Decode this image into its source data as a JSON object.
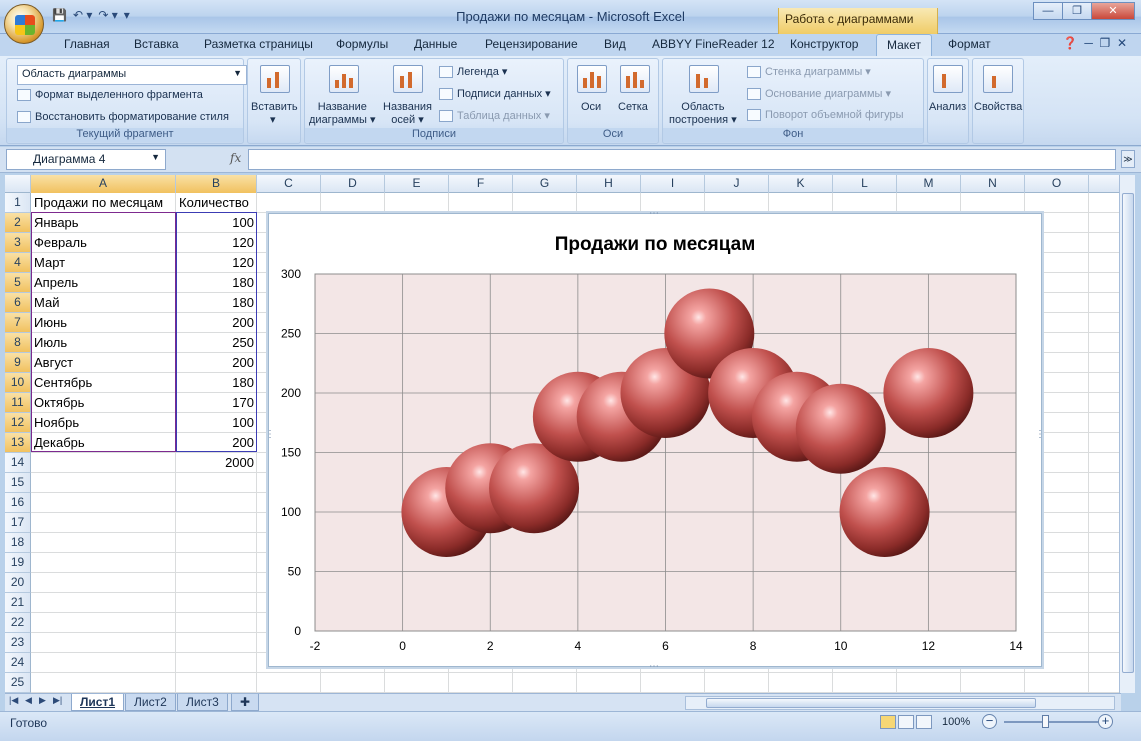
{
  "window": {
    "title": "Продажи по месяцам - Microsoft Excel",
    "context_title": "Работа с диаграммами",
    "controls": [
      "—",
      "❐",
      "✕"
    ]
  },
  "qat": {
    "save": "💾",
    "undo": "↶ ▾",
    "redo": "↷ ▾",
    "customize": "▾"
  },
  "tabs": [
    "Главная",
    "Вставка",
    "Разметка страницы",
    "Формулы",
    "Данные",
    "Рецензирование",
    "Вид",
    "ABBYY FineReader 12",
    "Конструктор",
    "Макет",
    "Формат"
  ],
  "active_tab": "Макет",
  "ribbon": {
    "current_selection": {
      "combo_value": "Область диаграммы",
      "format_selection": "Формат выделенного фрагмента",
      "reset_style": "Восстановить форматирование стиля",
      "group_label": "Текущий фрагмент"
    },
    "insert": {
      "label": "Вставить"
    },
    "labels": {
      "chart_title": "Название\nдиаграммы ▾",
      "axis_titles": "Названия\nосей ▾",
      "legend": "Легенда ▾",
      "data_labels": "Подписи данных ▾",
      "data_table": "Таблица данных ▾",
      "group_label": "Подписи"
    },
    "axes": {
      "axes": "Оси",
      "gridlines": "Сетка",
      "group_label": "Оси"
    },
    "background": {
      "plot_area": "Область\nпостроения ▾",
      "chart_wall": "Стенка диаграммы ▾",
      "chart_floor": "Основание диаграммы ▾",
      "rotation_3d": "Поворот объемной фигуры",
      "group_label": "Фон"
    },
    "analysis": {
      "label": "Анализ"
    },
    "properties": {
      "label": "Свойства"
    }
  },
  "formula_bar": {
    "name_box": "Диаграмма 4",
    "fx": "fx",
    "formula": ""
  },
  "columns": [
    "A",
    "B",
    "C",
    "D",
    "E",
    "F",
    "G",
    "H",
    "I",
    "J",
    "K",
    "L",
    "M",
    "N",
    "O"
  ],
  "rows": [
    "1",
    "2",
    "3",
    "4",
    "5",
    "6",
    "7",
    "8",
    "9",
    "10",
    "11",
    "12",
    "13",
    "14",
    "15",
    "16",
    "17",
    "18",
    "19",
    "20",
    "21",
    "22",
    "23",
    "24",
    "25"
  ],
  "sheet": {
    "header": [
      "Продажи по месяцам",
      "Количество"
    ],
    "data": [
      [
        "Январь",
        "100"
      ],
      [
        "Февраль",
        "120"
      ],
      [
        "Март",
        "120"
      ],
      [
        "Апрель",
        "180"
      ],
      [
        "Май",
        "180"
      ],
      [
        "Июнь",
        "200"
      ],
      [
        "Июль",
        "250"
      ],
      [
        "Август",
        "200"
      ],
      [
        "Сентябрь",
        "180"
      ],
      [
        "Октябрь",
        "170"
      ],
      [
        "Ноябрь",
        "100"
      ],
      [
        "Декабрь",
        "200"
      ]
    ],
    "total": "2000"
  },
  "sheet_tabs": [
    "Лист1",
    "Лист2",
    "Лист3"
  ],
  "active_sheet": "Лист1",
  "status": {
    "ready": "Готово",
    "zoom": "100%",
    "zoom_fraction": 0.5
  },
  "chart_data": {
    "type": "scatter",
    "title": "Продажи по месяцам",
    "x": [
      1,
      2,
      3,
      4,
      5,
      6,
      7,
      8,
      9,
      10,
      11,
      12
    ],
    "y": [
      100,
      120,
      120,
      180,
      180,
      200,
      250,
      200,
      180,
      170,
      100,
      200
    ],
    "xlim": [
      -2,
      14
    ],
    "ylim": [
      0,
      300
    ],
    "xticks": [
      -2,
      0,
      2,
      4,
      6,
      8,
      10,
      12,
      14
    ],
    "yticks": [
      0,
      50,
      100,
      150,
      200,
      250,
      300
    ],
    "grid": true,
    "plot_background": "#f3e6e6",
    "bubble_color": "#c0504d",
    "marker": "3d-sphere"
  }
}
